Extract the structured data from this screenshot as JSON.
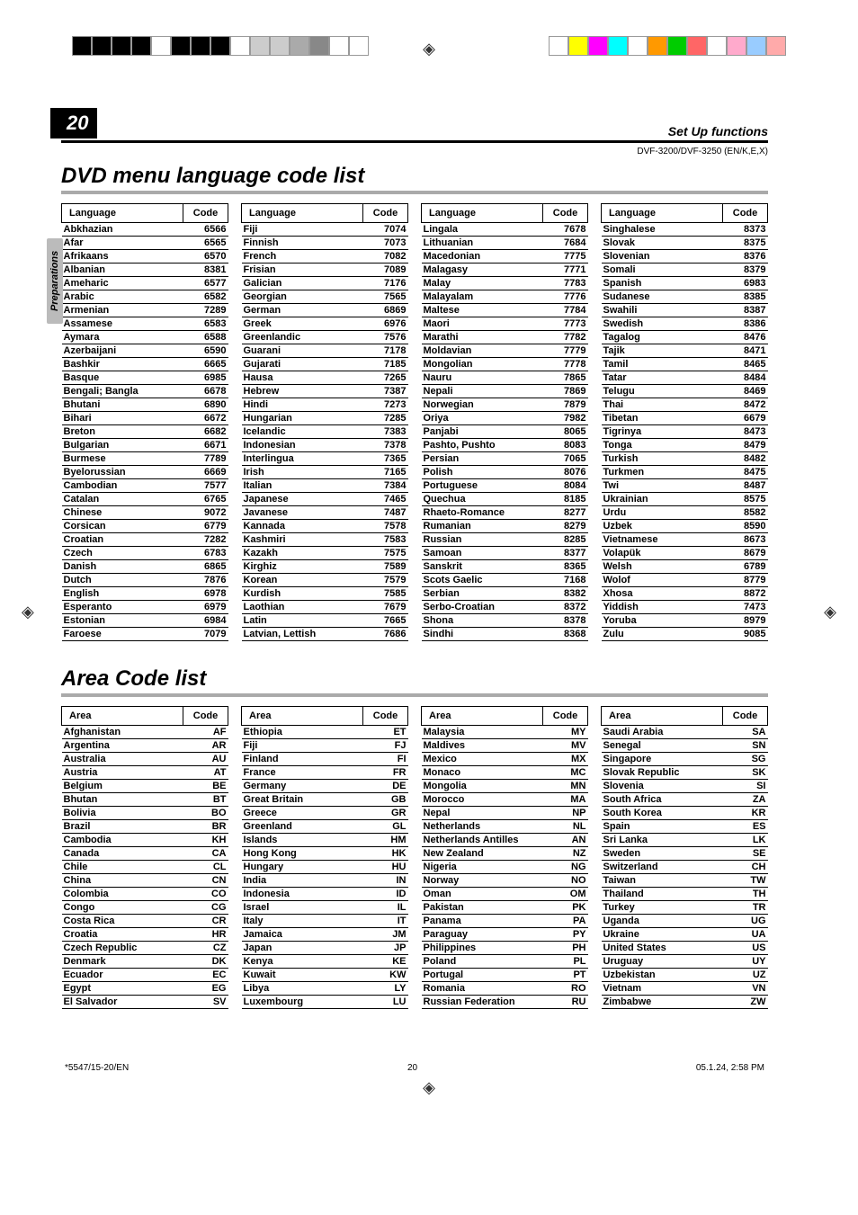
{
  "page_number": "20",
  "section_label": "Set Up functions",
  "model_line": "DVF-3200/DVF-3250 (EN/K,E,X)",
  "side_tab": "Preparations",
  "title_lang": "DVD menu language code list",
  "title_area": "Area Code list",
  "lang_headers": [
    "Language",
    "Code"
  ],
  "area_headers": [
    "Area",
    "Code"
  ],
  "lang_cols": [
    [
      [
        "Abkhazian",
        "6566"
      ],
      [
        "Afar",
        "6565"
      ],
      [
        "Afrikaans",
        "6570"
      ],
      [
        "Albanian",
        "8381"
      ],
      [
        "Ameharic",
        "6577"
      ],
      [
        "Arabic",
        "6582"
      ],
      [
        "Armenian",
        "7289"
      ],
      [
        "Assamese",
        "6583"
      ],
      [
        "Aymara",
        "6588"
      ],
      [
        "Azerbaijani",
        "6590"
      ],
      [
        "Bashkir",
        "6665"
      ],
      [
        "Basque",
        "6985"
      ],
      [
        "Bengali; Bangla",
        "6678"
      ],
      [
        "Bhutani",
        "6890"
      ],
      [
        "Bihari",
        "6672"
      ],
      [
        "Breton",
        "6682"
      ],
      [
        "Bulgarian",
        "6671"
      ],
      [
        "Burmese",
        "7789"
      ],
      [
        "Byelorussian",
        "6669"
      ],
      [
        "Cambodian",
        "7577"
      ],
      [
        "Catalan",
        "6765"
      ],
      [
        "Chinese",
        "9072"
      ],
      [
        "Corsican",
        "6779"
      ],
      [
        "Croatian",
        "7282"
      ],
      [
        "Czech",
        "6783"
      ],
      [
        "Danish",
        "6865"
      ],
      [
        "Dutch",
        "7876"
      ],
      [
        "English",
        "6978"
      ],
      [
        "Esperanto",
        "6979"
      ],
      [
        "Estonian",
        "6984"
      ],
      [
        "Faroese",
        "7079"
      ]
    ],
    [
      [
        "Fiji",
        "7074"
      ],
      [
        "Finnish",
        "7073"
      ],
      [
        "French",
        "7082"
      ],
      [
        "Frisian",
        "7089"
      ],
      [
        "Galician",
        "7176"
      ],
      [
        "Georgian",
        "7565"
      ],
      [
        "German",
        "6869"
      ],
      [
        "Greek",
        "6976"
      ],
      [
        "Greenlandic",
        "7576"
      ],
      [
        "Guarani",
        "7178"
      ],
      [
        "Gujarati",
        "7185"
      ],
      [
        "Hausa",
        "7265"
      ],
      [
        "Hebrew",
        "7387"
      ],
      [
        "Hindi",
        "7273"
      ],
      [
        "Hungarian",
        "7285"
      ],
      [
        "Icelandic",
        "7383"
      ],
      [
        "Indonesian",
        "7378"
      ],
      [
        "Interlingua",
        "7365"
      ],
      [
        "Irish",
        "7165"
      ],
      [
        "Italian",
        "7384"
      ],
      [
        "Japanese",
        "7465"
      ],
      [
        "Javanese",
        "7487"
      ],
      [
        "Kannada",
        "7578"
      ],
      [
        "Kashmiri",
        "7583"
      ],
      [
        "Kazakh",
        "7575"
      ],
      [
        "Kirghiz",
        "7589"
      ],
      [
        "Korean",
        "7579"
      ],
      [
        "Kurdish",
        "7585"
      ],
      [
        "Laothian",
        "7679"
      ],
      [
        "Latin",
        "7665"
      ],
      [
        "Latvian, Lettish",
        "7686"
      ]
    ],
    [
      [
        "Lingala",
        "7678"
      ],
      [
        "Lithuanian",
        "7684"
      ],
      [
        "Macedonian",
        "7775"
      ],
      [
        "Malagasy",
        "7771"
      ],
      [
        "Malay",
        "7783"
      ],
      [
        "Malayalam",
        "7776"
      ],
      [
        "Maltese",
        "7784"
      ],
      [
        "Maori",
        "7773"
      ],
      [
        "Marathi",
        "7782"
      ],
      [
        "Moldavian",
        "7779"
      ],
      [
        "Mongolian",
        "7778"
      ],
      [
        "Nauru",
        "7865"
      ],
      [
        "Nepali",
        "7869"
      ],
      [
        "Norwegian",
        "7879"
      ],
      [
        "Oriya",
        "7982"
      ],
      [
        "Panjabi",
        "8065"
      ],
      [
        "Pashto, Pushto",
        "8083"
      ],
      [
        "Persian",
        "7065"
      ],
      [
        "Polish",
        "8076"
      ],
      [
        "Portuguese",
        "8084"
      ],
      [
        "Quechua",
        "8185"
      ],
      [
        "Rhaeto-Romance",
        "8277"
      ],
      [
        "Rumanian",
        "8279"
      ],
      [
        "Russian",
        "8285"
      ],
      [
        "Samoan",
        "8377"
      ],
      [
        "Sanskrit",
        "8365"
      ],
      [
        "Scots Gaelic",
        "7168"
      ],
      [
        "Serbian",
        "8382"
      ],
      [
        "Serbo-Croatian",
        "8372"
      ],
      [
        "Shona",
        "8378"
      ],
      [
        "Sindhi",
        "8368"
      ]
    ],
    [
      [
        "Singhalese",
        "8373"
      ],
      [
        "Slovak",
        "8375"
      ],
      [
        "Slovenian",
        "8376"
      ],
      [
        "Somali",
        "8379"
      ],
      [
        "Spanish",
        "6983"
      ],
      [
        "Sudanese",
        "8385"
      ],
      [
        "Swahili",
        "8387"
      ],
      [
        "Swedish",
        "8386"
      ],
      [
        "Tagalog",
        "8476"
      ],
      [
        "Tajik",
        "8471"
      ],
      [
        "Tamil",
        "8465"
      ],
      [
        "Tatar",
        "8484"
      ],
      [
        "Telugu",
        "8469"
      ],
      [
        "Thai",
        "8472"
      ],
      [
        "Tibetan",
        "6679"
      ],
      [
        "Tigrinya",
        "8473"
      ],
      [
        "Tonga",
        "8479"
      ],
      [
        "Turkish",
        "8482"
      ],
      [
        "Turkmen",
        "8475"
      ],
      [
        "Twi",
        "8487"
      ],
      [
        "Ukrainian",
        "8575"
      ],
      [
        "Urdu",
        "8582"
      ],
      [
        "Uzbek",
        "8590"
      ],
      [
        "Vietnamese",
        "8673"
      ],
      [
        "Volapük",
        "8679"
      ],
      [
        "Welsh",
        "6789"
      ],
      [
        "Wolof",
        "8779"
      ],
      [
        "Xhosa",
        "8872"
      ],
      [
        "Yiddish",
        "7473"
      ],
      [
        "Yoruba",
        "8979"
      ],
      [
        "Zulu",
        "9085"
      ]
    ]
  ],
  "area_cols": [
    [
      [
        "Afghanistan",
        "AF"
      ],
      [
        "Argentina",
        "AR"
      ],
      [
        "Australia",
        "AU"
      ],
      [
        "Austria",
        "AT"
      ],
      [
        "Belgium",
        "BE"
      ],
      [
        "Bhutan",
        "BT"
      ],
      [
        "Bolivia",
        "BO"
      ],
      [
        "Brazil",
        "BR"
      ],
      [
        "Cambodia",
        "KH"
      ],
      [
        "Canada",
        "CA"
      ],
      [
        "Chile",
        "CL"
      ],
      [
        "China",
        "CN"
      ],
      [
        "Colombia",
        "CO"
      ],
      [
        "Congo",
        "CG"
      ],
      [
        "Costa Rica",
        "CR"
      ],
      [
        "Croatia",
        "HR"
      ],
      [
        "Czech Republic",
        "CZ"
      ],
      [
        "Denmark",
        "DK"
      ],
      [
        "Ecuador",
        "EC"
      ],
      [
        "Egypt",
        "EG"
      ],
      [
        "El Salvador",
        "SV"
      ]
    ],
    [
      [
        "Ethiopia",
        "ET"
      ],
      [
        "Fiji",
        "FJ"
      ],
      [
        "Finland",
        "FI"
      ],
      [
        "France",
        "FR"
      ],
      [
        "Germany",
        "DE"
      ],
      [
        "Great Britain",
        "GB"
      ],
      [
        "Greece",
        "GR"
      ],
      [
        "Greenland",
        "GL"
      ],
      [
        "Islands",
        "HM"
      ],
      [
        "Hong Kong",
        "HK"
      ],
      [
        "Hungary",
        "HU"
      ],
      [
        "India",
        "IN"
      ],
      [
        "Indonesia",
        "ID"
      ],
      [
        "Israel",
        "IL"
      ],
      [
        "Italy",
        "IT"
      ],
      [
        "Jamaica",
        "JM"
      ],
      [
        "Japan",
        "JP"
      ],
      [
        "Kenya",
        "KE"
      ],
      [
        "Kuwait",
        "KW"
      ],
      [
        "Libya",
        "LY"
      ],
      [
        "Luxembourg",
        "LU"
      ]
    ],
    [
      [
        "Malaysia",
        "MY"
      ],
      [
        "Maldives",
        "MV"
      ],
      [
        "Mexico",
        "MX"
      ],
      [
        "Monaco",
        "MC"
      ],
      [
        "Mongolia",
        "MN"
      ],
      [
        "Morocco",
        "MA"
      ],
      [
        "Nepal",
        "NP"
      ],
      [
        "Netherlands",
        "NL"
      ],
      [
        "Netherlands Antilles",
        "AN"
      ],
      [
        "New Zealand",
        "NZ"
      ],
      [
        "Nigeria",
        "NG"
      ],
      [
        "Norway",
        "NO"
      ],
      [
        "Oman",
        "OM"
      ],
      [
        "Pakistan",
        "PK"
      ],
      [
        "Panama",
        "PA"
      ],
      [
        "Paraguay",
        "PY"
      ],
      [
        "Philippines",
        "PH"
      ],
      [
        "Poland",
        "PL"
      ],
      [
        "Portugal",
        "PT"
      ],
      [
        "Romania",
        "RO"
      ],
      [
        "Russian Federation",
        "RU"
      ]
    ],
    [
      [
        "Saudi Arabia",
        "SA"
      ],
      [
        "Senegal",
        "SN"
      ],
      [
        "Singapore",
        "SG"
      ],
      [
        "Slovak Republic",
        "SK"
      ],
      [
        "Slovenia",
        "SI"
      ],
      [
        "South Africa",
        "ZA"
      ],
      [
        "South Korea",
        "KR"
      ],
      [
        "Spain",
        "ES"
      ],
      [
        "Sri Lanka",
        "LK"
      ],
      [
        "Sweden",
        "SE"
      ],
      [
        "Switzerland",
        "CH"
      ],
      [
        "Taiwan",
        "TW"
      ],
      [
        "Thailand",
        "TH"
      ],
      [
        "Turkey",
        "TR"
      ],
      [
        "Uganda",
        "UG"
      ],
      [
        "Ukraine",
        "UA"
      ],
      [
        "United States",
        "US"
      ],
      [
        "Uruguay",
        "UY"
      ],
      [
        "Uzbekistan",
        "UZ"
      ],
      [
        "Vietnam",
        "VN"
      ],
      [
        "Zimbabwe",
        "ZW"
      ]
    ]
  ],
  "crop_colors_left": [
    "#000",
    "#000",
    "#000",
    "#000",
    "#fff",
    "#000",
    "#000",
    "#000",
    "#fff",
    "#ccc",
    "#ccc",
    "#aaa",
    "#888",
    "#fff",
    "#fff"
  ],
  "crop_colors_right": [
    "#fff",
    "#ff0",
    "#f0f",
    "#0ff",
    "#fff",
    "#f90",
    "#0c0",
    "#f66",
    "#fff",
    "#fac",
    "#9cf",
    "#faa"
  ],
  "footer_left": "*5547/15-20/EN",
  "footer_center": "20",
  "footer_right": "05.1.24, 2:58 PM"
}
